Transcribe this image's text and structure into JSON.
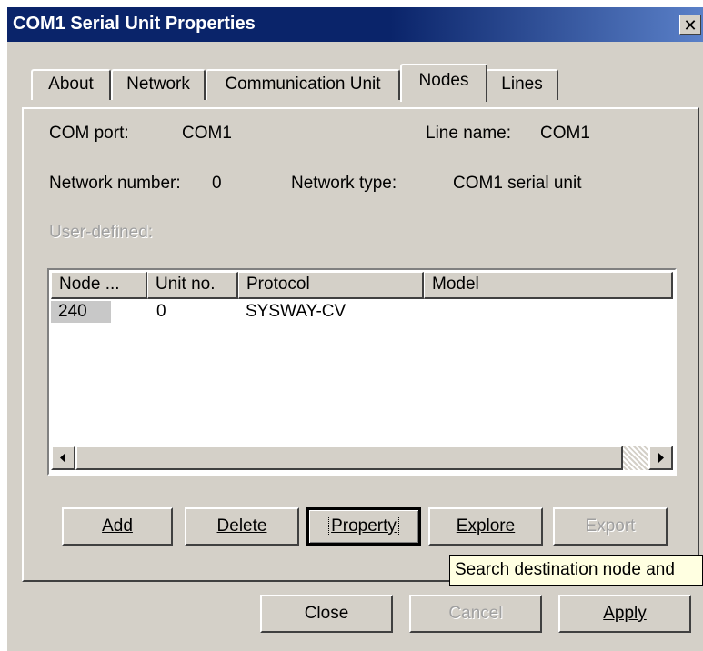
{
  "window": {
    "title": "COM1 Serial Unit Properties",
    "close_symbol": "✕"
  },
  "tabs": [
    {
      "label": "About"
    },
    {
      "label": "Network"
    },
    {
      "label": "Communication Unit"
    },
    {
      "label": "Nodes",
      "active": true
    },
    {
      "label": "Lines"
    }
  ],
  "info": {
    "com_port_label": "COM port:",
    "com_port_value": "COM1",
    "line_name_label": "Line name:",
    "line_name_value": "COM1",
    "network_number_label": "Network number:",
    "network_number_value": "0",
    "network_type_label": "Network type:",
    "network_type_value": "COM1 serial unit",
    "user_defined_label": "User-defined:"
  },
  "nodes_list": {
    "columns": [
      "Node ...",
      "Unit no.",
      "Protocol",
      "Model"
    ],
    "rows": [
      {
        "node": "240",
        "unit_no": "0",
        "protocol": "SYSWAY-CV",
        "model": ""
      }
    ]
  },
  "buttons": {
    "add": "Add",
    "delete": "Delete",
    "property": "Property",
    "explore": "Explore",
    "export": "Export",
    "close": "Close",
    "cancel": "Cancel",
    "apply": "Apply"
  },
  "tooltip": "Search destination node and"
}
